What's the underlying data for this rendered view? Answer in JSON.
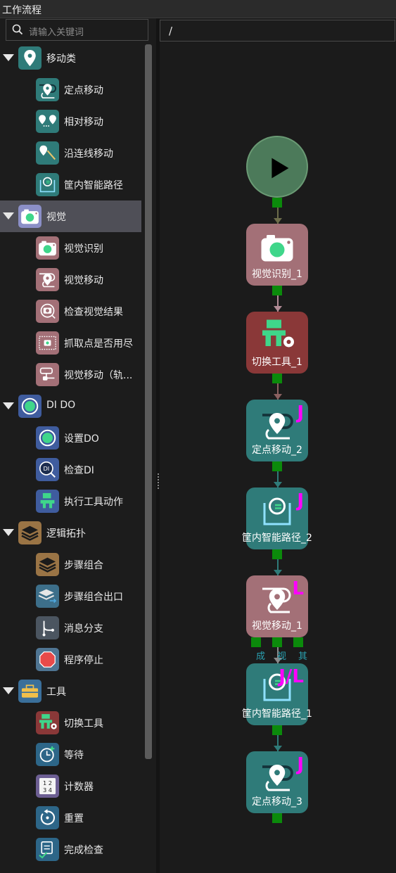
{
  "window": {
    "title": "工作流程"
  },
  "search": {
    "placeholder": "请输入关键词"
  },
  "breadcrumb": {
    "path": "/"
  },
  "sidebar": {
    "items": [
      {
        "label": "移动类",
        "kind": "category",
        "icon": "location-pin-icon",
        "color": "#2f7b79"
      },
      {
        "label": "定点移动",
        "kind": "child",
        "icon": "pin-route-icon",
        "color": "#2f7b79"
      },
      {
        "label": "相对移动",
        "kind": "child",
        "icon": "relative-move-icon",
        "color": "#2f7b79"
      },
      {
        "label": "沿连线移动",
        "kind": "child",
        "icon": "line-move-icon",
        "color": "#2f7b79"
      },
      {
        "label": "筐内智能路径",
        "kind": "child",
        "icon": "smart-path-icon",
        "color": "#2f7b79"
      },
      {
        "label": "视觉",
        "kind": "category",
        "selected": true,
        "icon": "camera-icon",
        "color": "#8b8fc7"
      },
      {
        "label": "视觉识别",
        "kind": "child",
        "icon": "camera-icon",
        "color": "#a37077"
      },
      {
        "label": "视觉移动",
        "kind": "child",
        "icon": "vision-move-icon",
        "color": "#a37077"
      },
      {
        "label": "检查视觉结果",
        "kind": "child",
        "icon": "check-vision-icon",
        "color": "#a37077"
      },
      {
        "label": "抓取点是否用尽",
        "kind": "child",
        "icon": "pick-point-icon",
        "color": "#a37077"
      },
      {
        "label": "视觉移动（轨...",
        "kind": "child",
        "icon": "vision-track-icon",
        "color": "#a37077"
      },
      {
        "label": "DI DO",
        "kind": "category",
        "icon": "io-icon",
        "color": "#3f5c9e"
      },
      {
        "label": "设置DO",
        "kind": "child",
        "icon": "set-do-icon",
        "color": "#3f5c9e"
      },
      {
        "label": "检查DI",
        "kind": "child",
        "icon": "check-di-icon",
        "color": "#3f5c9e"
      },
      {
        "label": "执行工具动作",
        "kind": "child",
        "icon": "tool-action-icon",
        "color": "#3f5c9e"
      },
      {
        "label": "逻辑拓扑",
        "kind": "category",
        "icon": "layers-icon",
        "color": "#9a7445"
      },
      {
        "label": "步骤组合",
        "kind": "child",
        "icon": "layers-icon",
        "color": "#9a7445"
      },
      {
        "label": "步骤组合出口",
        "kind": "child",
        "icon": "layers-exit-icon",
        "color": "#3d6f8a"
      },
      {
        "label": "消息分支",
        "kind": "child",
        "icon": "branch-icon",
        "color": "#4b5560"
      },
      {
        "label": "程序停止",
        "kind": "child",
        "icon": "stop-icon",
        "color": "#4f7593"
      },
      {
        "label": "工具",
        "kind": "category",
        "icon": "toolbox-icon",
        "color": "#3a6f9a"
      },
      {
        "label": "切换工具",
        "kind": "child",
        "icon": "switch-tool-icon",
        "color": "#8a3838"
      },
      {
        "label": "等待",
        "kind": "child",
        "icon": "clock-icon",
        "color": "#2d6688"
      },
      {
        "label": "计数器",
        "kind": "child",
        "icon": "counter-icon",
        "color": "#6d5f93"
      },
      {
        "label": "重置",
        "kind": "child",
        "icon": "reset-icon",
        "color": "#2d6688"
      },
      {
        "label": "完成检查",
        "kind": "child",
        "icon": "check-complete-icon",
        "color": "#2d6688"
      }
    ]
  },
  "flow": {
    "start": {
      "icon": "play-icon",
      "color": "#4c7a5a"
    },
    "nodes": [
      {
        "label": "视觉识别_1",
        "icon": "camera-icon",
        "color": "#a37077",
        "tag": ""
      },
      {
        "label": "切换工具_1",
        "icon": "switch-tool-icon",
        "color": "#8a3838",
        "tag": ""
      },
      {
        "label": "定点移动_2",
        "icon": "pin-route-icon",
        "color": "#2f7b79",
        "tag": "J"
      },
      {
        "label": "筐内智能路径_2",
        "icon": "smart-path-icon",
        "color": "#2f7b79",
        "tag": "J"
      },
      {
        "label": "视觉移动_1",
        "icon": "vision-move-icon",
        "color": "#a37077",
        "tag": "L"
      },
      {
        "label": "筐内智能路径_1",
        "icon": "smart-path-icon",
        "color": "#2f7b79",
        "tag": "J/L"
      },
      {
        "label": "定点移动_3",
        "icon": "pin-route-icon",
        "color": "#2f7b79",
        "tag": "J"
      }
    ],
    "branch_ports": [
      "成",
      "视",
      "其"
    ]
  }
}
